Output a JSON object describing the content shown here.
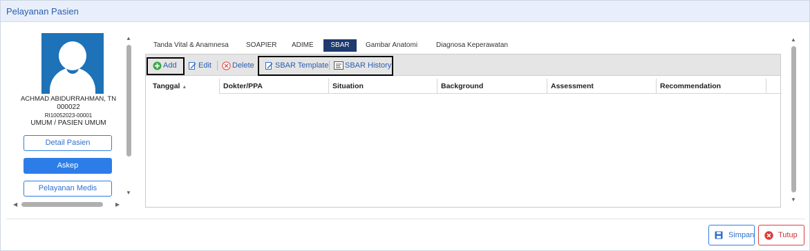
{
  "window": {
    "title": "Pelayanan Pasien"
  },
  "patient": {
    "name": "ACHMAD ABIDURRAHMAN, TN",
    "id": "000022",
    "registration": "RI10052023-00001",
    "type": "UMUM / PASIEN UMUM"
  },
  "side_buttons": {
    "detail": "Detail Pasien",
    "askep": "Askep",
    "pelayanan": "Pelayanan Medis"
  },
  "tabs": [
    {
      "label": "Tanda Vital & Anamnesa",
      "active": false
    },
    {
      "label": "SOAPIER",
      "active": false
    },
    {
      "label": "ADIME",
      "active": false
    },
    {
      "label": "SBAR",
      "active": true
    },
    {
      "label": "Gambar Anatomi",
      "active": false
    },
    {
      "label": "Diagnosa Keperawatan",
      "active": false
    }
  ],
  "toolbar": {
    "add": "Add",
    "edit": "Edit",
    "delete": "Delete",
    "sbar_template": "SBAR Template",
    "sbar_history": "SBAR History"
  },
  "columns": [
    {
      "label": "Tanggal",
      "sort": "asc"
    },
    {
      "label": "Dokter/PPA"
    },
    {
      "label": "Situation"
    },
    {
      "label": "Background"
    },
    {
      "label": "Assessment"
    },
    {
      "label": "Recommendation"
    }
  ],
  "rows": [],
  "footer": {
    "save": "Simpan",
    "close": "Tutup"
  },
  "colors": {
    "accent": "#2d7de8",
    "tab_active": "#1e3a6e",
    "danger": "#e03a3a",
    "avatar_bg": "#1d72b8"
  },
  "sort_indicator": "▲"
}
